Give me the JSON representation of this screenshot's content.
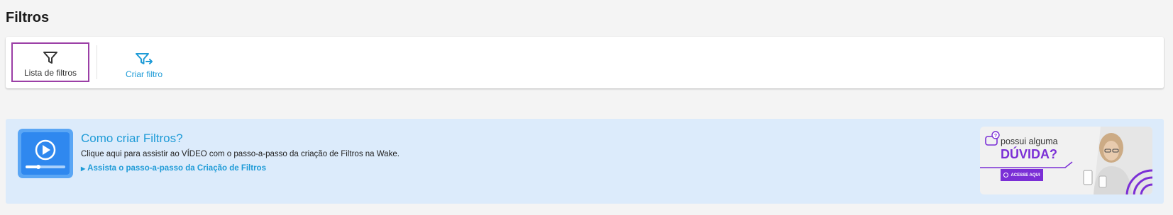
{
  "page": {
    "title": "Filtros"
  },
  "toolbar": {
    "list_label": "Lista de filtros",
    "create_label": "Criar filtro"
  },
  "help": {
    "title": "Como criar Filtros?",
    "description": "Clique aqui para assistir ao VÍDEO com o passo-a-passo da criação de Filtros na Wake.",
    "link_label": "Assista o passo-a-passo da Criação de Filtros",
    "icon": "video-play-icon"
  },
  "promo": {
    "line1": "possui alguma",
    "line2": "DÚVIDA?",
    "button": "ACESSE AQUI"
  },
  "colors": {
    "accent": "#1e9bd7",
    "selected_outline": "#9b3fa6",
    "banner_bg": "#dcebfb",
    "promo_purple": "#7b2fd6"
  }
}
